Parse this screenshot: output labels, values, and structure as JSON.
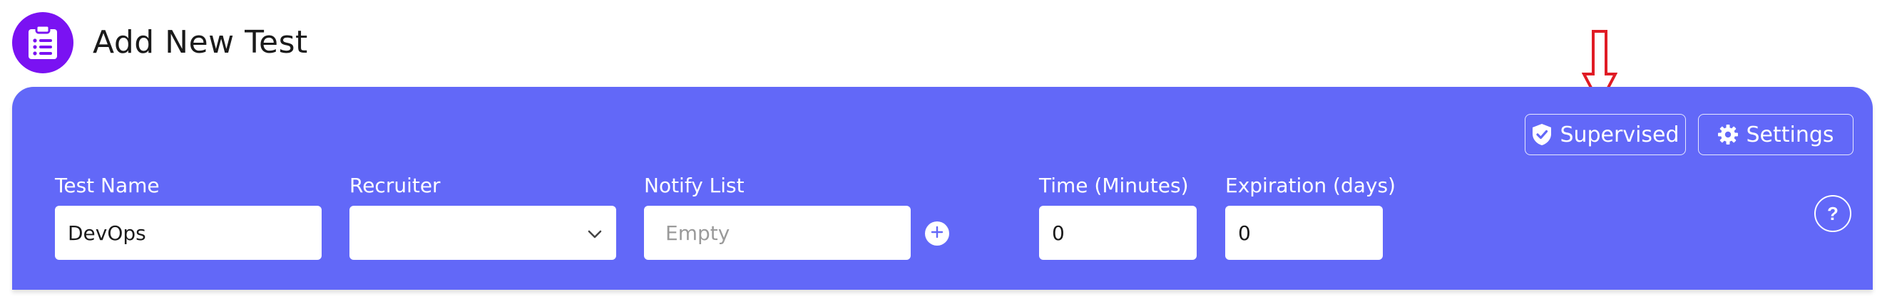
{
  "header": {
    "title": "Add New Test",
    "icon": "clipboard-list-icon",
    "icon_bg": "#7a12f2"
  },
  "panel": {
    "bg": "#6268f8"
  },
  "toolbar": {
    "supervised_label": "Supervised",
    "supervised_icon": "shield-check-icon",
    "settings_label": "Settings",
    "settings_icon": "gear-icon"
  },
  "fields": {
    "test_name": {
      "label": "Test Name",
      "value": "DevOps"
    },
    "recruiter": {
      "label": "Recruiter",
      "value": ""
    },
    "notify_list": {
      "label": "Notify List",
      "placeholder": "Empty"
    },
    "time_minutes": {
      "label": "Time (Minutes)",
      "value": "0"
    },
    "expiration_days": {
      "label": "Expiration (days)",
      "value": "0"
    }
  },
  "help": {
    "label": "?"
  },
  "annotation": {
    "arrow_color": "#e01b24",
    "points_to": "supervised-button"
  }
}
